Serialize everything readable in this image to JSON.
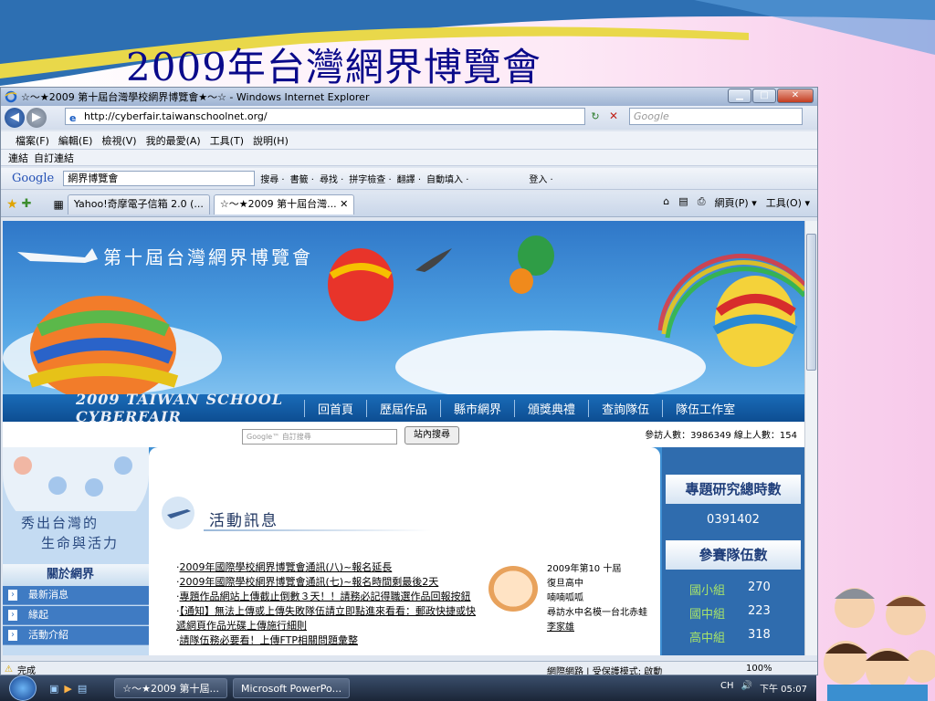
{
  "slide": {
    "title": "2009年台灣網界博覽會"
  },
  "window": {
    "title": "☆～★2009 第十屆台灣學校網界博覽會★～☆ - Windows Internet Explorer",
    "minimize": "▁",
    "maximize": "□",
    "close": "✕"
  },
  "address": {
    "url": "http://cyberfair.taiwanschoolnet.org/",
    "search_placeholder": "Google"
  },
  "menu": [
    "檔案(F)",
    "編輯(E)",
    "檢視(V)",
    "我的最愛(A)",
    "工具(T)",
    "說明(H)"
  ],
  "links": {
    "label": "連結",
    "item": "自訂連結"
  },
  "google_toolbar": {
    "logo": "Google",
    "query": "網界博覽會",
    "tools": [
      "搜尋 ·",
      "書籤 ·",
      "尋找 ·",
      "拼字檢查 ·",
      "翻譯 ·",
      "自動填入 ·",
      "登入 ·"
    ]
  },
  "tabs": [
    {
      "label": "Yahoo!奇摩電子信箱 2.0 (..."
    },
    {
      "label": "☆～★2009 第十屆台灣... ✕"
    }
  ],
  "command_bar": [
    "網頁(P) ▾",
    "工具(O) ▾"
  ],
  "page": {
    "banner_title": "第十屆台灣網界博覽會",
    "logo_text": "2009 TAIWAN SCHOOL CYBERFAIR",
    "nav": [
      "回首頁",
      "歷屆作品",
      "縣市網界",
      "頒獎典禮",
      "查詢隊伍",
      "隊伍工作室"
    ],
    "search_placeholder": "Google™ 自訂搜尋",
    "search_button": "站內搜尋",
    "visitors": "參訪人數：3986349 線上人數：154",
    "motto_line1": "秀出台灣的",
    "motto_line2": "生命與活力",
    "about_title": "關於網界",
    "side_items": [
      "最新消息",
      "緣起",
      "活動介紹"
    ],
    "news_title": "活動訊息",
    "news": [
      "2009年國際學校網界博覽會通訊(八)~報名延長",
      "2009年國際學校網界博覽會通訊(七)~報名時間剩最後2天",
      "專題作品網站上傳截止倒數３天！！請務必記得職選作品回報按鈕",
      "【通知】無法上傳或上傳失敗隊伍請立即點進來看看：郵政快捷或快遞網頁作品光碟上傳施行細則",
      "請隊伍務必要看！上傳FTP相關問題彙整"
    ],
    "featured": {
      "line1": "2009年第10 十屆",
      "line2": "復旦高中",
      "line3": "喃喃呱呱",
      "line4": "尋訪水中名模一台北赤蛙",
      "author": "李家雄"
    },
    "right": {
      "hours_title": "專題研究總時數",
      "hours_value": "0391402",
      "teams_title": "參賽隊伍數",
      "teams": [
        {
          "label": "國小組",
          "count": "270"
        },
        {
          "label": "國中組",
          "count": "223"
        },
        {
          "label": "高中組",
          "count": "318"
        }
      ]
    }
  },
  "status": {
    "done": "完成",
    "zone": "網際網路 | 受保護模式: 啟動",
    "zoom": "100%"
  },
  "taskbar": {
    "tasks": [
      "☆～★2009 第十屆...",
      "Microsoft PowerPo..."
    ],
    "lang": "CH",
    "clock": "下午 05:07"
  },
  "colors": {
    "slide_title": "#0a0a8a",
    "banner_sky": "#2f77c8",
    "nav_strip": "#0d4e92",
    "sidebar_item": "#3f7bc3",
    "team_label": "#a6e36a"
  }
}
